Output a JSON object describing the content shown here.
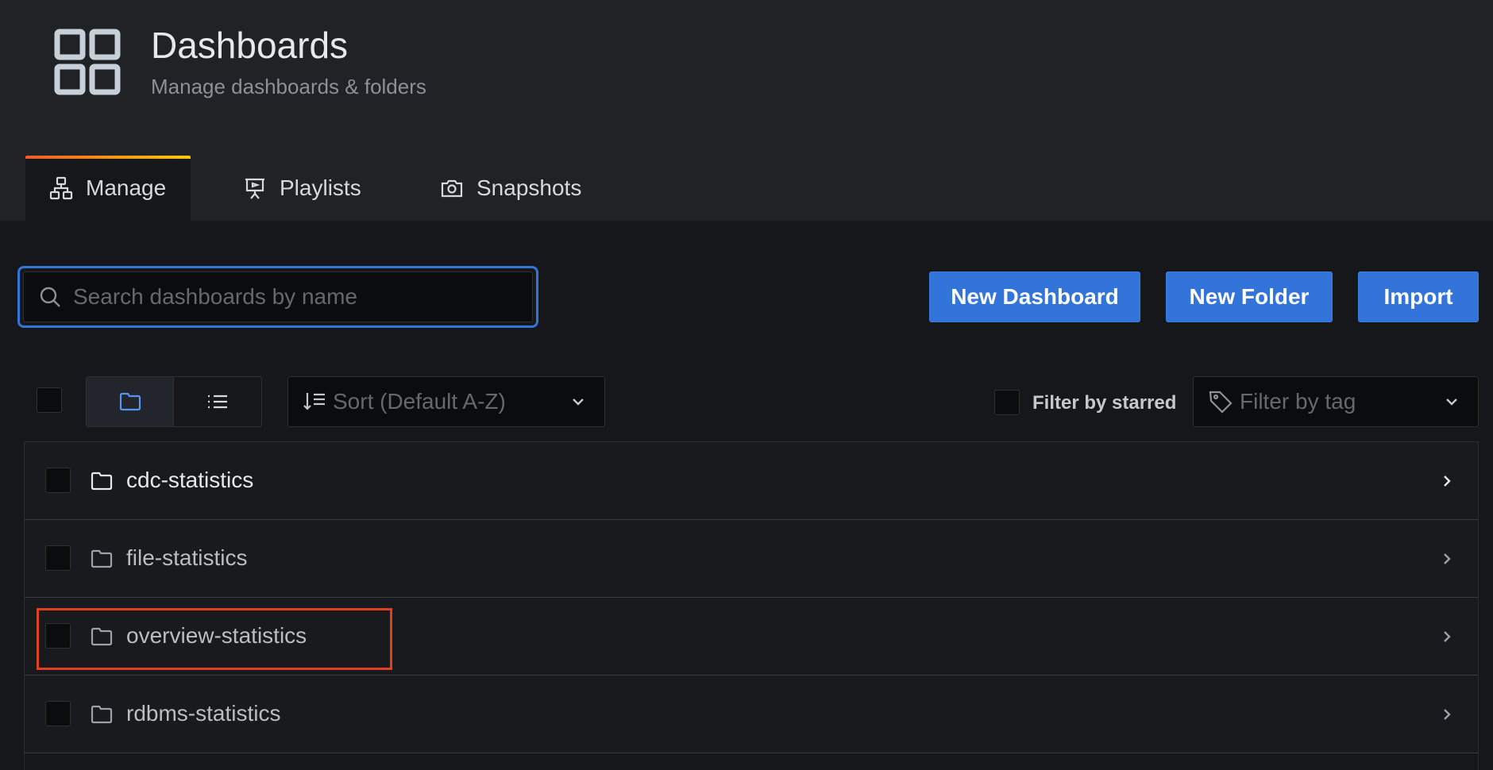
{
  "header": {
    "title": "Dashboards",
    "subtitle": "Manage dashboards & folders",
    "icon": "dashboards-grid-icon"
  },
  "tabs": [
    {
      "label": "Manage",
      "icon": "sitemap-icon",
      "active": true
    },
    {
      "label": "Playlists",
      "icon": "presentation-icon",
      "active": false
    },
    {
      "label": "Snapshots",
      "icon": "camera-icon",
      "active": false
    }
  ],
  "search": {
    "placeholder": "Search dashboards by name",
    "value": ""
  },
  "actions": {
    "new_dashboard": "New Dashboard",
    "new_folder": "New Folder",
    "import": "Import"
  },
  "toolbar": {
    "view_mode": "folders",
    "sort_label": "Sort (Default A-Z)",
    "filter_starred_label": "Filter by starred",
    "filter_tag_placeholder": "Filter by tag"
  },
  "folders": [
    {
      "name": "cdc-statistics"
    },
    {
      "name": "file-statistics"
    },
    {
      "name": "overview-statistics"
    },
    {
      "name": "rdbms-statistics"
    }
  ],
  "colors": {
    "accent": "#3274d9",
    "highlight": "#e0401f",
    "background": "#16171b"
  }
}
